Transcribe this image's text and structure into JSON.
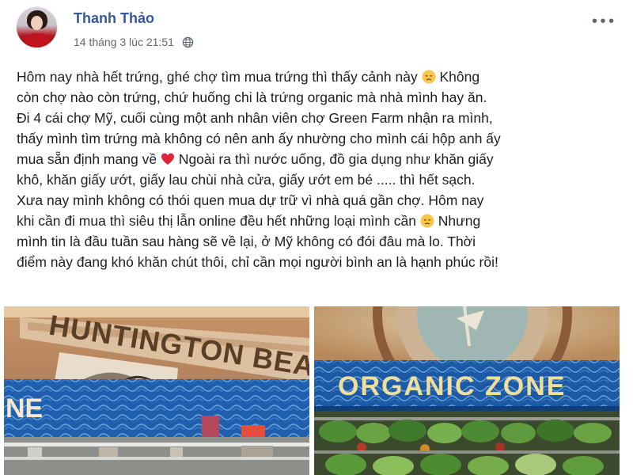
{
  "post": {
    "author_name": "Thanh Thảo",
    "timestamp": "14 tháng 3 lúc 21:51",
    "privacy_icon": "globe-icon",
    "more_icon": "more-options-icon",
    "body": {
      "line1": "Hôm nay nhà hết trứng, ghé chợ tìm mua trứng thì thấy cảnh này",
      "line1b": "Không",
      "line2": "còn chợ nào còn trứng, chứ huống chi là trứng organic mà nhà mình hay ăn.",
      "line3": "Đi 4 cái chợ Mỹ, cuối cùng một anh nhân viên chợ Green Farm nhận ra mình,",
      "line4": "thấy mình tìm trứng mà không có nên anh ấy nhường cho mình cái hộp anh ấy",
      "line5": "mua sẵn định mang về",
      "line5b": "Ngoài ra thì nước uống, đồ gia dụng như khăn giấy",
      "line6": "khô, khăn giấy ướt, giấy lau chùi nhà cửa, giấy ướt em bé ..... thì hết sạch.",
      "line7": "Xưa nay mình không có thói quen mua dự trữ vì nhà quá gần chợ. Hôm nay",
      "line8": "khi cần đi mua thì siêu thị lẫn online đều hết những loại mình cần",
      "line8b": "Nhưng",
      "line9": "mình tin là đầu tuần sau hàng sẽ về lại, ở Mỹ không có đói đâu mà lo. Thời",
      "line10": "điểm này đang khó khăn chút thôi, chỉ cần mọi người bình an là hạnh phúc rồi!"
    },
    "photos": {
      "left_sign": "HUNTINGTON BEAC",
      "left_side_text": "NE",
      "right_sign": "ORGANIC ZONE"
    }
  }
}
